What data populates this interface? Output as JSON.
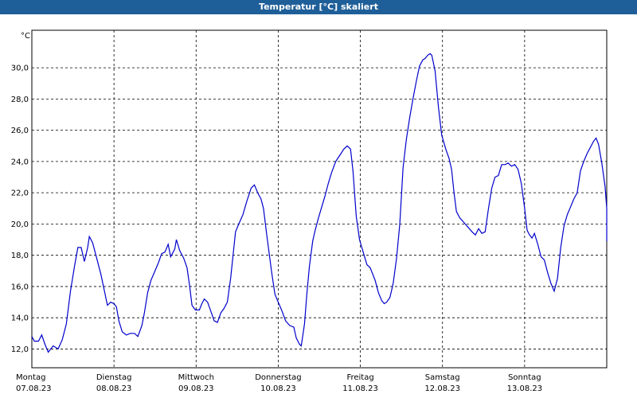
{
  "window": {
    "title": "Temperatur [°C] skaliert"
  },
  "chart_data": {
    "type": "line",
    "title": "Temperatur [°C] skaliert",
    "ylabel": "°C",
    "xlabel": "",
    "ylim": [
      10.8,
      32.4
    ],
    "y_ticks": [
      "12,0",
      "14,0",
      "16,0",
      "18,0",
      "20,0",
      "22,0",
      "24,0",
      "26,0",
      "28,0",
      "30,0"
    ],
    "y_tick_values": [
      12,
      14,
      16,
      18,
      20,
      22,
      24,
      26,
      28,
      30
    ],
    "x_range_days": [
      0,
      7
    ],
    "day_labels": [
      {
        "day": "Montag",
        "date": "07.08.23"
      },
      {
        "day": "Dienstag",
        "date": "08.08.23"
      },
      {
        "day": "Mittwoch",
        "date": "09.08.23"
      },
      {
        "day": "Donnerstag",
        "date": "10.08.23"
      },
      {
        "day": "Freitag",
        "date": "11.08.23"
      },
      {
        "day": "Samstag",
        "date": "12.08.23"
      },
      {
        "day": "Sonntag",
        "date": "13.08.23"
      }
    ],
    "grid": true,
    "series": [
      {
        "color": "#0000cc",
        "points": [
          [
            0.0,
            12.8
          ],
          [
            0.03,
            12.5
          ],
          [
            0.08,
            12.5
          ],
          [
            0.12,
            12.9
          ],
          [
            0.16,
            12.3
          ],
          [
            0.2,
            11.8
          ],
          [
            0.26,
            12.2
          ],
          [
            0.32,
            12.0
          ],
          [
            0.37,
            12.6
          ],
          [
            0.42,
            13.6
          ],
          [
            0.47,
            15.7
          ],
          [
            0.52,
            17.3
          ],
          [
            0.56,
            18.5
          ],
          [
            0.6,
            18.5
          ],
          [
            0.64,
            17.6
          ],
          [
            0.68,
            18.5
          ],
          [
            0.7,
            19.2
          ],
          [
            0.74,
            18.8
          ],
          [
            0.78,
            18.0
          ],
          [
            0.84,
            16.8
          ],
          [
            0.88,
            15.8
          ],
          [
            0.92,
            14.8
          ],
          [
            0.96,
            15.0
          ],
          [
            1.0,
            14.9
          ],
          [
            1.03,
            14.7
          ],
          [
            1.06,
            13.8
          ],
          [
            1.1,
            13.1
          ],
          [
            1.15,
            12.9
          ],
          [
            1.2,
            13.0
          ],
          [
            1.25,
            13.0
          ],
          [
            1.29,
            12.8
          ],
          [
            1.34,
            13.5
          ],
          [
            1.37,
            14.3
          ],
          [
            1.41,
            15.6
          ],
          [
            1.45,
            16.4
          ],
          [
            1.5,
            17.0
          ],
          [
            1.54,
            17.5
          ],
          [
            1.58,
            18.1
          ],
          [
            1.62,
            18.2
          ],
          [
            1.66,
            18.7
          ],
          [
            1.69,
            17.9
          ],
          [
            1.74,
            18.4
          ],
          [
            1.76,
            19.0
          ],
          [
            1.8,
            18.3
          ],
          [
            1.85,
            17.8
          ],
          [
            1.89,
            17.2
          ],
          [
            1.92,
            16.1
          ],
          [
            1.95,
            14.8
          ],
          [
            1.99,
            14.5
          ],
          [
            2.04,
            14.5
          ],
          [
            2.07,
            14.9
          ],
          [
            2.1,
            15.2
          ],
          [
            2.14,
            15.0
          ],
          [
            2.18,
            14.4
          ],
          [
            2.22,
            13.8
          ],
          [
            2.26,
            13.7
          ],
          [
            2.3,
            14.3
          ],
          [
            2.34,
            14.6
          ],
          [
            2.38,
            15.0
          ],
          [
            2.42,
            16.5
          ],
          [
            2.45,
            18.0
          ],
          [
            2.48,
            19.5
          ],
          [
            2.52,
            20.0
          ],
          [
            2.57,
            20.6
          ],
          [
            2.62,
            21.5
          ],
          [
            2.67,
            22.3
          ],
          [
            2.71,
            22.5
          ],
          [
            2.75,
            22.0
          ],
          [
            2.79,
            21.6
          ],
          [
            2.82,
            21.0
          ],
          [
            2.86,
            19.3
          ],
          [
            2.89,
            18.1
          ],
          [
            2.92,
            16.9
          ],
          [
            2.96,
            15.5
          ],
          [
            3.0,
            15.0
          ],
          [
            3.04,
            14.5
          ],
          [
            3.09,
            13.8
          ],
          [
            3.14,
            13.5
          ],
          [
            3.19,
            13.4
          ],
          [
            3.22,
            12.7
          ],
          [
            3.26,
            12.3
          ],
          [
            3.28,
            12.2
          ],
          [
            3.3,
            12.9
          ],
          [
            3.32,
            13.6
          ],
          [
            3.35,
            15.6
          ],
          [
            3.38,
            17.3
          ],
          [
            3.42,
            18.9
          ],
          [
            3.45,
            19.6
          ],
          [
            3.49,
            20.4
          ],
          [
            3.53,
            21.1
          ],
          [
            3.57,
            21.8
          ],
          [
            3.61,
            22.6
          ],
          [
            3.65,
            23.3
          ],
          [
            3.7,
            24.0
          ],
          [
            3.75,
            24.4
          ],
          [
            3.8,
            24.8
          ],
          [
            3.84,
            25.0
          ],
          [
            3.88,
            24.8
          ],
          [
            3.91,
            23.4
          ],
          [
            3.95,
            20.5
          ],
          [
            3.99,
            19.0
          ],
          [
            4.04,
            18.1
          ],
          [
            4.08,
            17.4
          ],
          [
            4.12,
            17.2
          ],
          [
            4.15,
            16.8
          ],
          [
            4.18,
            16.4
          ],
          [
            4.22,
            15.6
          ],
          [
            4.26,
            15.1
          ],
          [
            4.29,
            14.9
          ],
          [
            4.32,
            15.0
          ],
          [
            4.36,
            15.3
          ],
          [
            4.4,
            16.2
          ],
          [
            4.44,
            17.8
          ],
          [
            4.48,
            20.0
          ],
          [
            4.52,
            23.6
          ],
          [
            4.56,
            25.4
          ],
          [
            4.6,
            26.8
          ],
          [
            4.64,
            28.0
          ],
          [
            4.68,
            29.1
          ],
          [
            4.72,
            30.1
          ],
          [
            4.76,
            30.5
          ],
          [
            4.79,
            30.6
          ],
          [
            4.82,
            30.8
          ],
          [
            4.85,
            30.9
          ],
          [
            4.87,
            30.8
          ],
          [
            4.91,
            29.8
          ],
          [
            4.95,
            27.5
          ],
          [
            4.99,
            25.7
          ],
          [
            5.04,
            24.8
          ],
          [
            5.08,
            24.2
          ],
          [
            5.11,
            23.5
          ],
          [
            5.14,
            22.0
          ],
          [
            5.17,
            20.8
          ],
          [
            5.21,
            20.4
          ],
          [
            5.26,
            20.1
          ],
          [
            5.31,
            19.8
          ],
          [
            5.36,
            19.5
          ],
          [
            5.4,
            19.3
          ],
          [
            5.44,
            19.7
          ],
          [
            5.48,
            19.4
          ],
          [
            5.52,
            19.5
          ],
          [
            5.56,
            21.0
          ],
          [
            5.6,
            22.3
          ],
          [
            5.64,
            23.0
          ],
          [
            5.68,
            23.1
          ],
          [
            5.72,
            23.8
          ],
          [
            5.76,
            23.8
          ],
          [
            5.8,
            23.9
          ],
          [
            5.84,
            23.7
          ],
          [
            5.88,
            23.8
          ],
          [
            5.92,
            23.5
          ],
          [
            5.96,
            22.6
          ],
          [
            6.0,
            21.0
          ],
          [
            6.03,
            19.6
          ],
          [
            6.06,
            19.3
          ],
          [
            6.09,
            19.1
          ],
          [
            6.12,
            19.4
          ],
          [
            6.16,
            18.7
          ],
          [
            6.2,
            17.9
          ],
          [
            6.24,
            17.7
          ],
          [
            6.28,
            16.9
          ],
          [
            6.32,
            16.2
          ],
          [
            6.36,
            15.7
          ],
          [
            6.4,
            16.5
          ],
          [
            6.44,
            18.5
          ],
          [
            6.48,
            19.9
          ],
          [
            6.52,
            20.6
          ],
          [
            6.56,
            21.1
          ],
          [
            6.6,
            21.6
          ],
          [
            6.64,
            22.0
          ],
          [
            6.68,
            23.4
          ],
          [
            6.72,
            24.0
          ],
          [
            6.76,
            24.5
          ],
          [
            6.8,
            24.9
          ],
          [
            6.84,
            25.3
          ],
          [
            6.87,
            25.5
          ],
          [
            6.9,
            25.1
          ],
          [
            6.94,
            23.9
          ],
          [
            6.98,
            22.4
          ],
          [
            7.01,
            21.0
          ],
          [
            7.04,
            20.1
          ],
          [
            7.07,
            19.6
          ],
          [
            7.1,
            19.3
          ],
          [
            7.14,
            18.9
          ]
        ]
      }
    ]
  }
}
